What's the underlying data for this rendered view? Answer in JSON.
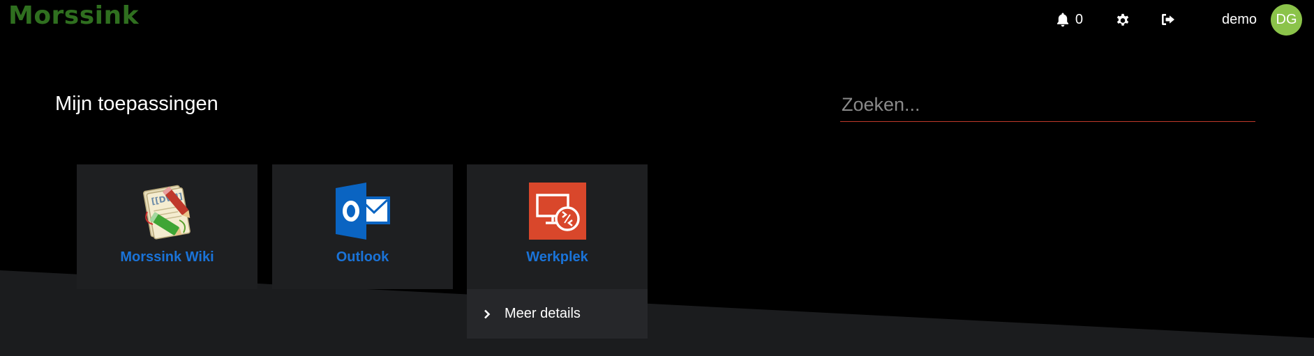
{
  "header": {
    "logo": "Morssink",
    "notifications_count": "0",
    "username": "demo",
    "avatar_initials": "DG"
  },
  "main": {
    "title": "Mijn toepassingen",
    "search": {
      "placeholder": "Zoeken...",
      "value": ""
    },
    "apps": [
      {
        "label": "Morssink Wiki",
        "icon": "dokuwiki-icon"
      },
      {
        "label": "Outlook",
        "icon": "outlook-icon"
      },
      {
        "label": "Werkplek",
        "icon": "remote-desktop-icon",
        "details_label": "Meer details"
      }
    ]
  },
  "colors": {
    "background": "#000000",
    "slant": "#1b1c1e",
    "tile": "#1e1f21",
    "tile_details": "#26272a",
    "link": "#1a73d8",
    "search_underline": "#c0392b",
    "avatar": "#8bc34a",
    "logo": "#2f6f1f"
  }
}
